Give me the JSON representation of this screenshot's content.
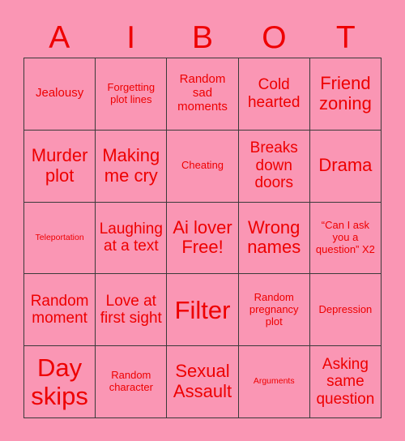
{
  "card": {
    "background_color": "#fa96b4",
    "text_color": "#ee0000",
    "border_color": "#3a3a3a",
    "header": {
      "letters": [
        "A",
        "I",
        "B",
        "O",
        "T"
      ]
    },
    "grid": {
      "columns": 5,
      "rows": 5,
      "cells": [
        [
          {
            "text": "Jealousy",
            "size": "m"
          },
          {
            "text": "Forgetting plot lines",
            "size": "s"
          },
          {
            "text": "Random sad moments",
            "size": "m"
          },
          {
            "text": "Cold hearted",
            "size": "l"
          },
          {
            "text": "Friend zoning",
            "size": "xl"
          }
        ],
        [
          {
            "text": "Murder plot",
            "size": "xl"
          },
          {
            "text": "Making me cry",
            "size": "xl"
          },
          {
            "text": "Cheating",
            "size": "s"
          },
          {
            "text": "Breaks down doors",
            "size": "l"
          },
          {
            "text": "Drama",
            "size": "xl"
          }
        ],
        [
          {
            "text": "Teleportation",
            "size": "xs"
          },
          {
            "text": "Laughing at a text",
            "size": "l"
          },
          {
            "text": "Ai lover Free!",
            "size": "xl"
          },
          {
            "text": "Wrong names",
            "size": "xl"
          },
          {
            "text": "“Can I ask you a question” X2",
            "size": "s"
          }
        ],
        [
          {
            "text": "Random moment",
            "size": "l"
          },
          {
            "text": "Love at first sight",
            "size": "l"
          },
          {
            "text": "Filter",
            "size": "xxl"
          },
          {
            "text": "Random pregnancy plot",
            "size": "s"
          },
          {
            "text": "Depression",
            "size": "s"
          }
        ],
        [
          {
            "text": "Day skips",
            "size": "xxl"
          },
          {
            "text": "Random character",
            "size": "s"
          },
          {
            "text": "Sexual Assault",
            "size": "xl"
          },
          {
            "text": "Arguments",
            "size": "xs"
          },
          {
            "text": "Asking same question",
            "size": "l"
          }
        ]
      ]
    }
  }
}
